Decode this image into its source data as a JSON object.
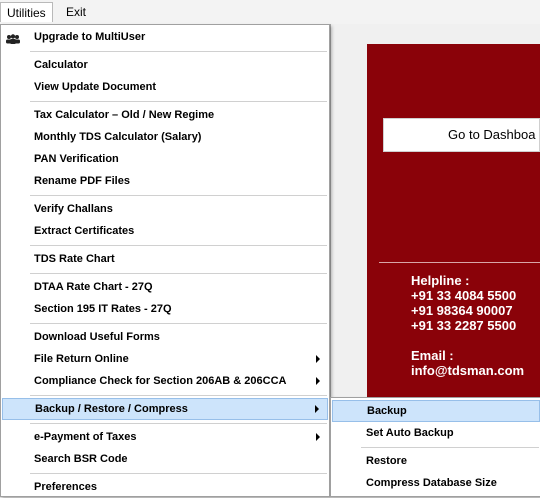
{
  "menubar": {
    "items": [
      "Utilities",
      "Exit"
    ]
  },
  "menu": {
    "items": [
      {
        "label": "Upgrade to MultiUser"
      },
      {
        "label": "Calculator"
      },
      {
        "label": "View Update Document"
      },
      {
        "label": "Tax Calculator – Old / New Regime"
      },
      {
        "label": "Monthly TDS Calculator (Salary)"
      },
      {
        "label": "PAN Verification"
      },
      {
        "label": "Rename PDF Files"
      },
      {
        "label": "Verify Challans"
      },
      {
        "label": "Extract Certificates"
      },
      {
        "label": "TDS Rate Chart"
      },
      {
        "label": "DTAA Rate Chart - 27Q"
      },
      {
        "label": "Section 195 IT Rates - 27Q"
      },
      {
        "label": "Download Useful Forms"
      },
      {
        "label": "File Return Online"
      },
      {
        "label": "Compliance Check for Section 206AB & 206CCA"
      },
      {
        "label": "Backup / Restore / Compress"
      },
      {
        "label": "e-Payment of Taxes"
      },
      {
        "label": "Search BSR Code"
      },
      {
        "label": "Preferences"
      }
    ]
  },
  "submenu": {
    "items": [
      {
        "label": "Backup"
      },
      {
        "label": "Set Auto Backup"
      },
      {
        "label": "Restore"
      },
      {
        "label": "Compress Database Size"
      }
    ]
  },
  "background": {
    "dashboard_button": "Go to Dashboa",
    "helpline_title": "Helpline :",
    "phones": [
      "+91 33 4084 5500",
      "+91 98364 90007",
      "+91 33 2287 5500"
    ],
    "email_title": "Email :",
    "email": "info@tdsman.com"
  },
  "colors": {
    "panel_red": "#8a0209",
    "highlight": "#cde4fb"
  }
}
